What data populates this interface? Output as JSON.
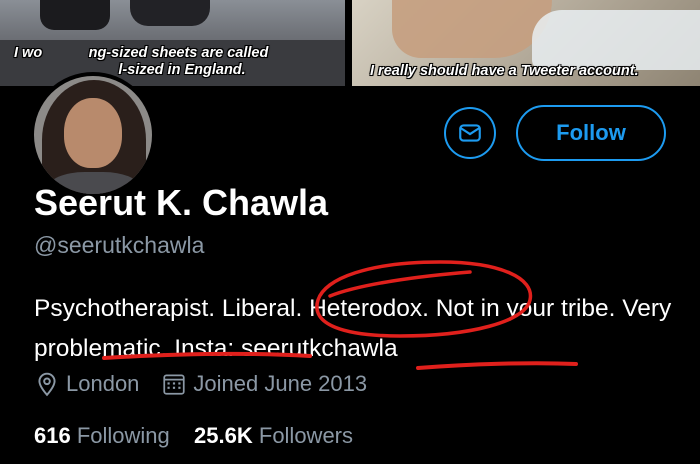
{
  "banner": {
    "caption_left": "I wo    ng-sized sheets are called\n        l-sized in England.",
    "caption_right": "I really should have a Tweeter account."
  },
  "profile": {
    "name": "Seerut K. Chawla",
    "handle": "@seerutkchawla",
    "bio": "Psychotherapist. Liberal. Heterodox. Not in your tribe. Very problematic. Insta: seerutkchawla",
    "location": "London",
    "joined": "Joined June 2013"
  },
  "actions": {
    "follow_label": "Follow",
    "message_icon": "envelope-icon"
  },
  "stats": {
    "following_count": "616",
    "following_label": "Following",
    "followers_count": "25.6K",
    "followers_label": "Followers"
  },
  "colors": {
    "accent": "#1d9bf0",
    "secondary_text": "#8b98a5",
    "annotation": "#e0201c"
  }
}
